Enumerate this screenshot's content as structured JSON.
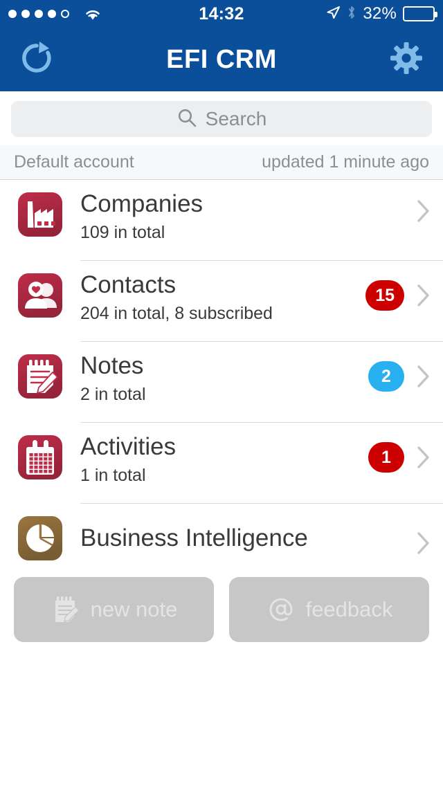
{
  "status_bar": {
    "signal_dots_filled": 4,
    "signal_dots_total": 5,
    "wifi_icon": "wifi-icon",
    "time": "14:32",
    "location_icon": "location-arrow-icon",
    "bluetooth_icon": "bluetooth-icon",
    "battery_percent_label": "32%",
    "battery_level": 32
  },
  "nav": {
    "refresh_icon": "refresh-icon",
    "title": "EFI CRM",
    "settings_icon": "gear-icon"
  },
  "search": {
    "icon": "search-icon",
    "placeholder": "Search",
    "value": ""
  },
  "account": {
    "name": "Default account",
    "updated": "updated 1 minute ago"
  },
  "colors": {
    "navbar_blue": "#0b4f9b",
    "nav_icon_blue": "#7fbbe8",
    "crimson_icon": "#bf2d49",
    "gold_icon": "#9a7640",
    "badge_red": "#cc0000",
    "badge_blue": "#28b0f0",
    "button_gray": "#c7c7c7"
  },
  "list": {
    "items": [
      {
        "key": "companies",
        "icon": "factory-icon",
        "icon_color": "#bf2d49",
        "title": "Companies",
        "subtitle": "109 in total",
        "badge": null,
        "badge_color": null,
        "chevron": "chevron-right-icon",
        "divider": true
      },
      {
        "key": "contacts",
        "icon": "contacts-icon",
        "icon_color": "#bf2d49",
        "title": "Contacts",
        "subtitle": "204 in total, 8 subscribed",
        "badge": "15",
        "badge_color": "#cc0000",
        "chevron": "chevron-right-icon",
        "divider": true
      },
      {
        "key": "notes",
        "icon": "notepad-icon",
        "icon_color": "#bf2d49",
        "title": "Notes",
        "subtitle": "2 in total",
        "badge": "2",
        "badge_color": "#28b0f0",
        "chevron": "chevron-right-icon",
        "divider": true
      },
      {
        "key": "activities",
        "icon": "calendar-icon",
        "icon_color": "#bf2d49",
        "title": "Activities",
        "subtitle": "1 in total",
        "badge": "1",
        "badge_color": "#cc0000",
        "chevron": "chevron-right-icon",
        "divider": true
      },
      {
        "key": "business-intelligence",
        "icon": "pie-chart-icon",
        "icon_color": "#9a7640",
        "title": "Business Intelligence",
        "subtitle": null,
        "badge": null,
        "badge_color": null,
        "chevron": "chevron-right-icon",
        "divider": false
      }
    ]
  },
  "actions": {
    "new_note": {
      "icon": "notepad-icon",
      "label": "new note"
    },
    "feedback": {
      "icon": "at-sign-icon",
      "label": "feedback"
    }
  }
}
